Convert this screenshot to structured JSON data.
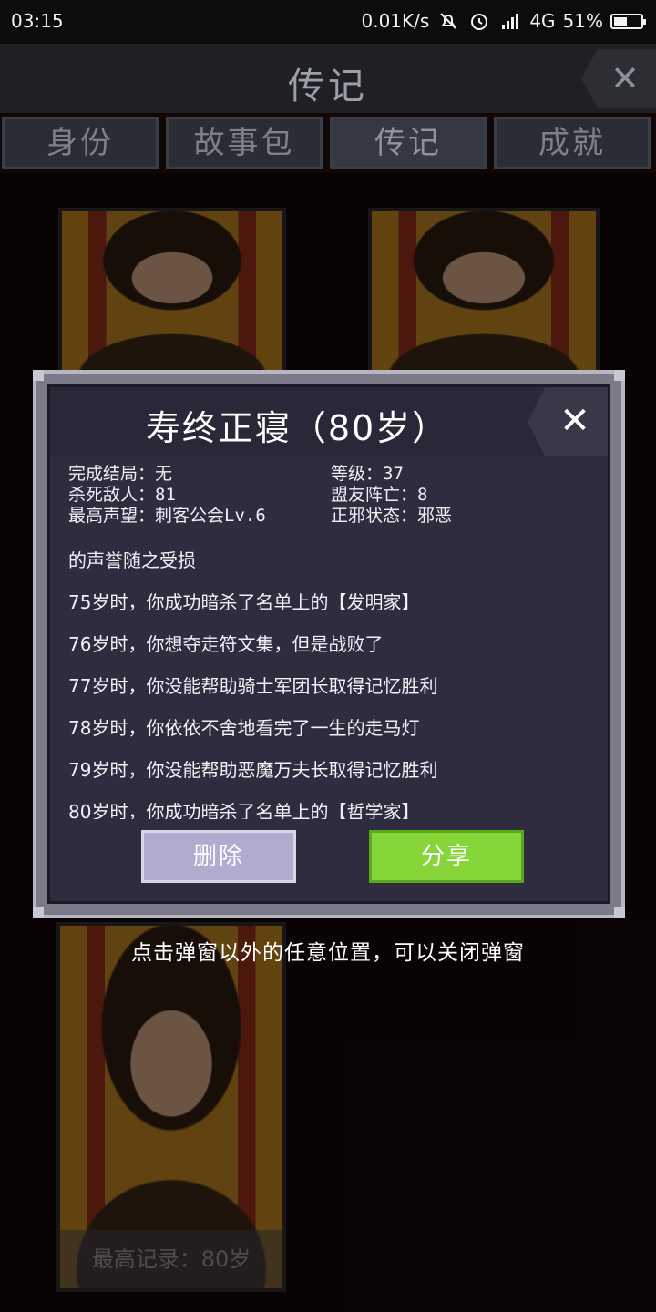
{
  "status_bar": {
    "time": "03:15",
    "net_speed": "0.01K/s",
    "network": "4G",
    "battery_pct": "51%",
    "battery_level": 0.51,
    "icons": [
      "mute-bell-icon",
      "alarm-icon",
      "signal-icon",
      "battery-icon"
    ]
  },
  "header": {
    "title": "传记",
    "close": "✕"
  },
  "tabs": [
    {
      "label": "身份"
    },
    {
      "label": "故事包"
    },
    {
      "label": "传记",
      "active": true
    },
    {
      "label": "成就"
    }
  ],
  "cards": {
    "bottom_left_footer": "最高记录：80岁"
  },
  "hint": "点击弹窗以外的任意位置，可以关闭弹窗",
  "modal": {
    "title": "寿终正寝（80岁）",
    "close": "✕",
    "stats": {
      "ending": "完成结局：无",
      "level": "等级：37",
      "kills": "杀死敌人：81",
      "ally_deaths": "盟友阵亡：8",
      "reputation": "最高声望：刺客公会Lv.6",
      "alignment": "正邪状态：邪恶"
    },
    "log": [
      "的声誉随之受损",
      "75岁时，你成功暗杀了名单上的【发明家】",
      "76岁时，你想夺走符文集，但是战败了",
      "77岁时，你没能帮助骑士军团长取得记忆胜利",
      "78岁时，你依依不舍地看完了一生的走马灯",
      "79岁时，你没能帮助恶魔万夫长取得记忆胜利",
      "80岁时，你成功暗杀了名单上的【哲学家】"
    ],
    "delete_label": "删除",
    "share_label": "分享"
  },
  "colors": {
    "background": "#120707",
    "modal_panel": "#2f2c3f",
    "delete_button": "#b0accf",
    "share_button": "#86d63a"
  }
}
